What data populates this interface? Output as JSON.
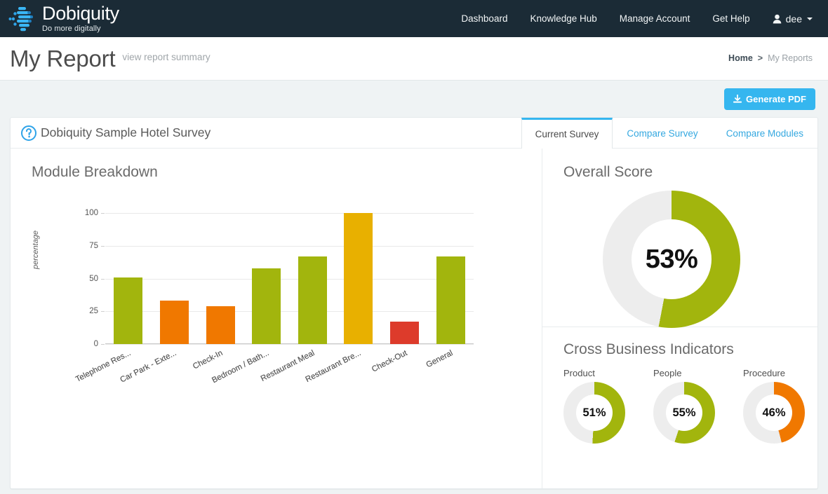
{
  "topbar": {
    "brand_name": "Dobiquity",
    "brand_tagline": "Do more digitally",
    "nav": [
      {
        "label": "Dashboard"
      },
      {
        "label": "Knowledge Hub"
      },
      {
        "label": "Manage Account"
      },
      {
        "label": "Get Help"
      }
    ],
    "user": {
      "name": "dee",
      "icon": "user-icon",
      "caret": "chevron-down-icon"
    },
    "background": "#1b2b36"
  },
  "titlebar": {
    "title": "My Report",
    "subtitle": "view report summary",
    "breadcrumb": {
      "home": "Home",
      "separator": ">",
      "current": "My Reports"
    }
  },
  "actionbar": {
    "generate_pdf_label": "Generate PDF",
    "generate_pdf_icon": "download-icon",
    "accent": "#35b6ef"
  },
  "card": {
    "survey_title": "Dobiquity Sample Hotel Survey",
    "survey_icon": "question-circle-icon",
    "tabs": [
      {
        "label": "Current Survey",
        "active": true
      },
      {
        "label": "Compare Survey",
        "active": false
      },
      {
        "label": "Compare Modules",
        "active": false
      }
    ]
  },
  "module_breakdown": {
    "heading": "Module Breakdown"
  },
  "overall_score": {
    "heading": "Overall Score",
    "value": 53,
    "value_label": "53%",
    "color": "#a2b50d",
    "track": "#ededed"
  },
  "cross_business_indicators": {
    "heading": "Cross Business Indicators",
    "items": [
      {
        "label": "Product",
        "value": 51,
        "value_label": "51%",
        "color": "#a2b50d"
      },
      {
        "label": "People",
        "value": 55,
        "value_label": "55%",
        "color": "#a2b50d"
      },
      {
        "label": "Procedure",
        "value": 46,
        "value_label": "46%",
        "color": "#f07800"
      }
    ],
    "track": "#ededed"
  },
  "chart_data": {
    "type": "bar",
    "title": "Module Breakdown",
    "xlabel": "",
    "ylabel": "percentage",
    "ylim": [
      0,
      100
    ],
    "yticks": [
      0,
      25,
      50,
      75,
      100
    ],
    "grid": true,
    "legend": "none",
    "categories": [
      "Telephone Res...",
      "Car Park - Exte...",
      "Check-In",
      "Bedroom / Bath...",
      "Restaurant Meal",
      "Restaurant Bre...",
      "Check-Out",
      "General"
    ],
    "values": [
      51,
      33,
      29,
      58,
      67,
      100,
      17,
      67
    ],
    "colors": [
      "#a2b50d",
      "#f07800",
      "#f07800",
      "#a2b50d",
      "#a2b50d",
      "#e8b000",
      "#dd3b2b",
      "#a2b50d"
    ]
  }
}
